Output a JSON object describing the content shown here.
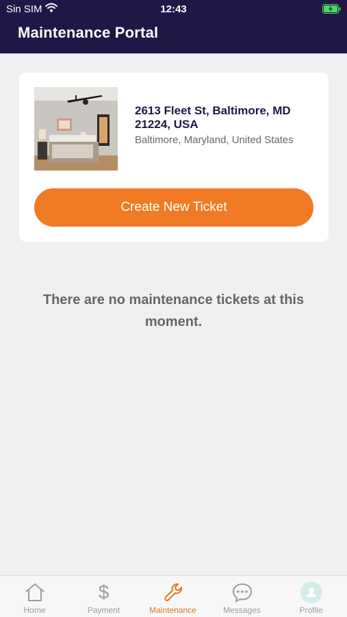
{
  "status_bar": {
    "carrier": "Sin SIM",
    "time": "12:43"
  },
  "header": {
    "title": "Maintenance Portal"
  },
  "property": {
    "address": "2613 Fleet St, Baltimore, MD 21224, USA",
    "location": "Baltimore, Maryland, United States",
    "create_ticket_label": "Create New Ticket"
  },
  "empty_state": "There are no maintenance tickets at this moment.",
  "tabs": [
    {
      "label": "Home",
      "icon": "home-icon"
    },
    {
      "label": "Payment",
      "icon": "dollar-icon"
    },
    {
      "label": "Maintenance",
      "icon": "wrench-icon"
    },
    {
      "label": "Messages",
      "icon": "chat-icon"
    },
    {
      "label": "Profile",
      "icon": "profile-icon"
    }
  ],
  "active_tab": "Maintenance",
  "colors": {
    "header": "#1f1846",
    "accent": "#f07b24",
    "background": "#f0f0f0",
    "tab_inactive": "#9a9aa8"
  }
}
